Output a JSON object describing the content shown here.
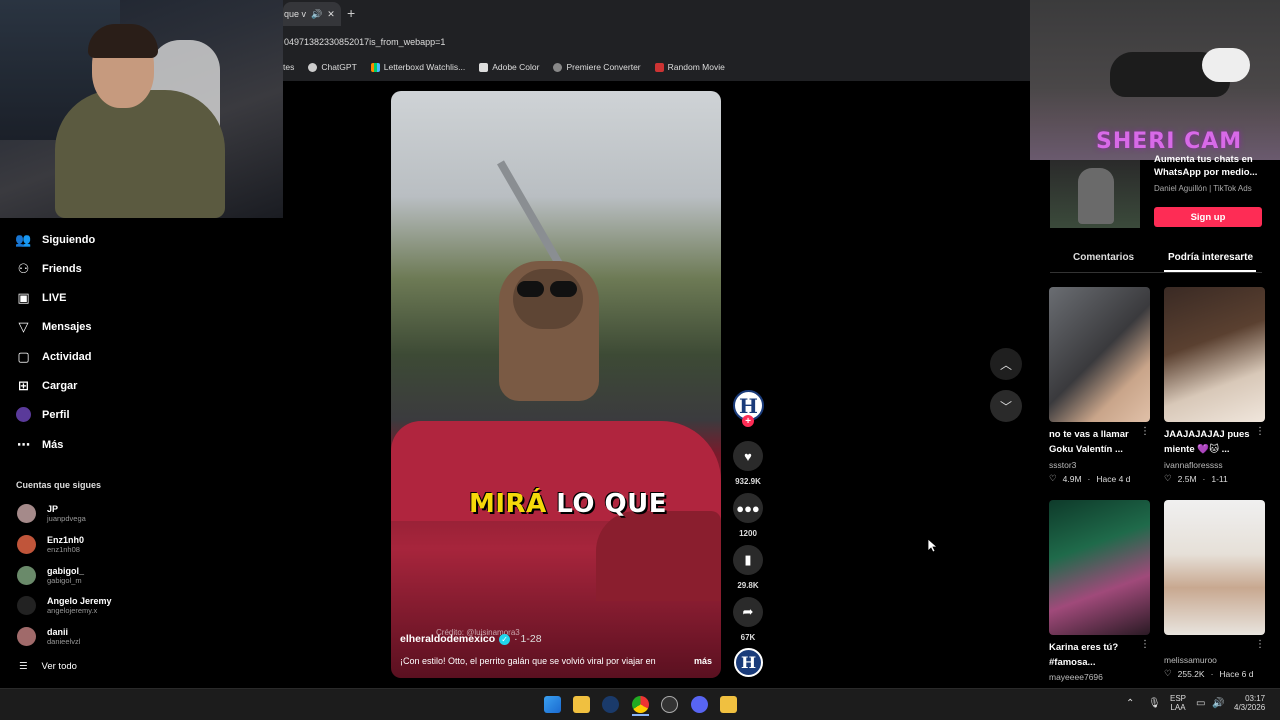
{
  "browser": {
    "tab_title": "que v",
    "url_fragment": "04971382330852017is_from_webapp=1",
    "bookmarks": [
      {
        "label": "tes",
        "icon": "none"
      },
      {
        "label": "ChatGPT",
        "icon": "chatgpt-icon"
      },
      {
        "label": "Letterboxd Watchlis...",
        "icon": "letterboxd-icon"
      },
      {
        "label": "Adobe Color",
        "icon": "adobe-icon"
      },
      {
        "label": "Premiere Converter",
        "icon": "globe-icon"
      },
      {
        "label": "Random Movie",
        "icon": "movie-icon"
      }
    ]
  },
  "sidebar": {
    "nav": [
      {
        "label": "Siguiendo",
        "icon": "people-icon"
      },
      {
        "label": "Friends",
        "icon": "friends-icon"
      },
      {
        "label": "LIVE",
        "icon": "live-icon"
      },
      {
        "label": "Mensajes",
        "icon": "send-icon"
      },
      {
        "label": "Actividad",
        "icon": "activity-icon"
      },
      {
        "label": "Cargar",
        "icon": "upload-icon"
      },
      {
        "label": "Perfil",
        "icon": "avatar"
      },
      {
        "label": "Más",
        "icon": "more-icon"
      }
    ],
    "following_title": "Cuentas que sigues",
    "following": [
      {
        "name": "JP",
        "handle": "juanpdvega",
        "color": "#a58a8a"
      },
      {
        "name": "Enz1nh0",
        "handle": "enz1nh08",
        "color": "#c0553a"
      },
      {
        "name": "gabigol_",
        "handle": "gabigol_m",
        "color": "#6a8a6a"
      },
      {
        "name": "Angelo Jeremy",
        "handle": "angelojeremy.x",
        "color": "#222"
      },
      {
        "name": "danii",
        "handle": "danieelvzl",
        "color": "#a06a6a"
      }
    ],
    "see_all": "Ver todo"
  },
  "video": {
    "overlay_text_yellow": "MIRÁ",
    "overlay_text_white": "LO QUE",
    "credit": "Crédito: @luisinamora3",
    "author": "elheraldodemexico",
    "date": "· 1-28",
    "description": "¡Con estilo! Otto, el perrito galán que se volvió viral por viajar en",
    "more": "más"
  },
  "actions": {
    "avatar_letter": "H",
    "likes": "932.9K",
    "comments": "1200",
    "saves": "29.8K",
    "shares": "67K"
  },
  "right": {
    "cam_label": "SHERI CAM",
    "ad_title": "Aumenta tus chats en WhatsApp por medio...",
    "ad_source": "Daniel Aguillón | TikTok Ads",
    "signup": "Sign up",
    "tab_comments": "Comentarios",
    "tab_interest": "Podría interesarte",
    "cards": [
      {
        "title": "no te vas a llamar Goku Valentín ...",
        "user": "ssstor3",
        "likes": "4.9M",
        "time": "Hace 4 d"
      },
      {
        "title": "JAAJAJAJAJ pues miente 💜🐱 ...",
        "user": "ivannafloressss",
        "likes": "2.5M",
        "time": "1-11"
      },
      {
        "title": "Karina eres tú? #famosa...",
        "user": "mayeeee7696",
        "likes": "",
        "time": ""
      },
      {
        "title": "",
        "user": "melissamuroo",
        "likes": "255.2K",
        "time": "Hace 6 d"
      }
    ]
  },
  "taskbar": {
    "lang1": "ESP",
    "lang2": "LAA",
    "time": "03:17",
    "date": "4/3/2026"
  }
}
